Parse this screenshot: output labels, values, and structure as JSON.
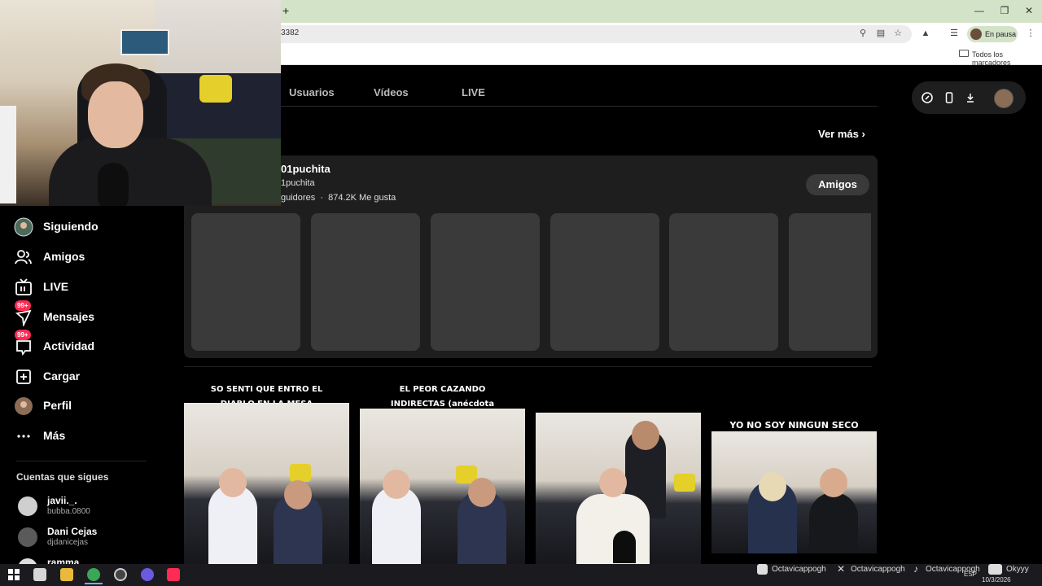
{
  "browser": {
    "url_fragment": "3382",
    "profile_status": "En pausa",
    "bookmarks_folder": "Todos los marcadores",
    "new_tab": "+"
  },
  "tabs": [
    {
      "label": "Usuarios"
    },
    {
      "label": "Vídeos"
    },
    {
      "label": "LIVE"
    }
  ],
  "sidebar": {
    "items": [
      {
        "label": "Siguiendo",
        "icon": "following-avatar-icon"
      },
      {
        "label": "Amigos",
        "icon": "friends-icon"
      },
      {
        "label": "LIVE",
        "icon": "live-tv-icon"
      },
      {
        "label": "Mensajes",
        "icon": "messages-icon",
        "badge": "99+"
      },
      {
        "label": "Actividad",
        "icon": "activity-icon",
        "badge": "99+"
      },
      {
        "label": "Cargar",
        "icon": "upload-icon"
      },
      {
        "label": "Perfil",
        "icon": "profile-avatar-icon"
      },
      {
        "label": "Más",
        "icon": "more-dots-icon"
      }
    ],
    "following_title": "Cuentas que sigues",
    "following": [
      {
        "name": "javii._.",
        "handle": "bubba.0800"
      },
      {
        "name": "Dani Cejas",
        "handle": "djdanicejas"
      },
      {
        "name": "ramma",
        "handle": ""
      }
    ]
  },
  "main": {
    "ver_mas": "Ver más",
    "user_card": {
      "name": "01puchita",
      "handle": "1puchita",
      "followers_fragment": "guidores",
      "separator": "·",
      "likes": "874.2K Me gusta",
      "button": "Amigos"
    },
    "videos": [
      {
        "caption": "SO SENTI QUE ENTRO EL DIABLO EN LA MESA"
      },
      {
        "caption": "EL PEOR CAZANDO INDIRECTAS (anécdota completa)"
      },
      {
        "caption": ""
      },
      {
        "caption": "YO NO SOY NINGUN SECO"
      }
    ]
  },
  "taskbar": {
    "socials": [
      {
        "label": "Octavicappogh",
        "icon": "instagram-icon"
      },
      {
        "label": "Octavicappogh",
        "icon": "x-icon"
      },
      {
        "label": "Octavicappogh",
        "icon": "tiktok-icon"
      },
      {
        "label": "Okyyy",
        "icon": "youtube-icon"
      }
    ],
    "lang": "ESP",
    "date": "10/3/2026"
  },
  "colors": {
    "accent": "#fe2c55",
    "tab_strip": "#d3e3c7",
    "card_bg": "#1e1e1e"
  }
}
